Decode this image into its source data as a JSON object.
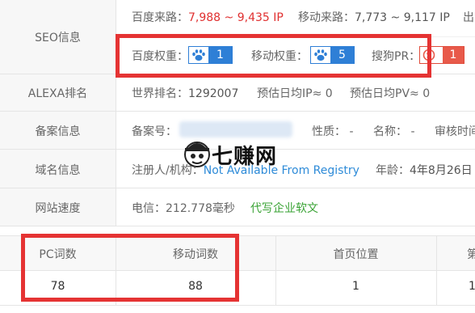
{
  "seo": {
    "label": "SEO信息",
    "baidu_source_label": "百度来路：",
    "baidu_source_value": "7,988 ~ 9,435 IP",
    "mobile_source_label": "移动来路：",
    "mobile_source_value": "7,773 ~ 9,117 IP",
    "cut_text": "出",
    "baidu_weight_label": "百度权重：",
    "baidu_weight_value": "1",
    "mobile_weight_label": "移动权重：",
    "mobile_weight_value": "5",
    "sogou_pr_label": "搜狗PR：",
    "sogou_pr_value": "1"
  },
  "alexa": {
    "label": "ALEXA排名",
    "world_rank_label": "世界排名：",
    "world_rank_value": "1292007",
    "daily_ip": "预估日均IP≈ 0",
    "daily_pv": "预估日均PV≈ 0"
  },
  "icp": {
    "label": "备案信息",
    "record_no_label": "备案号：",
    "nature": "性质： -",
    "name": "名称： -",
    "audit_time": "审核时间"
  },
  "domain": {
    "label": "域名信息",
    "registrant_label": "注册人/机构：",
    "registrant_value": "Not Available From Registry",
    "age_label": "年龄：",
    "age_value": "4年8月26日"
  },
  "speed": {
    "label": "网站速度",
    "telecom": "电信：212.778毫秒",
    "ad_link": "代写企业软文"
  },
  "watermark": {
    "text": "七赚网"
  },
  "rank_table": {
    "headers": [
      "PC词数",
      "移动词数",
      "首页位置",
      "第"
    ],
    "values": [
      "78",
      "88",
      "1",
      "1"
    ]
  },
  "colors": {
    "red": "#e03030",
    "blue": "#2e7fd6",
    "green": "#3aa335",
    "highlight_box": "#e53333"
  }
}
